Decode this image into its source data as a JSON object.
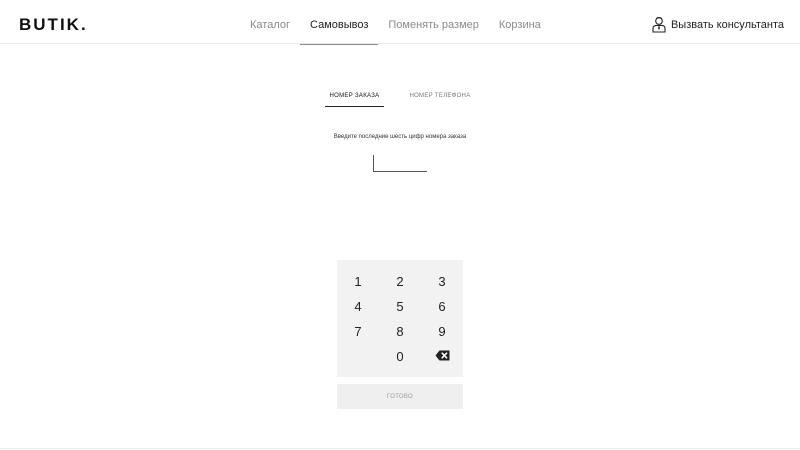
{
  "header": {
    "logo": "BUTIK.",
    "nav": [
      {
        "label": "Каталог",
        "active": false
      },
      {
        "label": "Самовывоз",
        "active": true
      },
      {
        "label": "Поменять размер",
        "active": false
      },
      {
        "label": "Корзина",
        "active": false
      }
    ],
    "consultant": {
      "label": "Вызвать консультанта",
      "icon": "consultant-person-icon"
    }
  },
  "tabs": [
    {
      "label": "НОМЕР ЗАКАЗА",
      "active": true
    },
    {
      "label": "НОМЕР ТЕЛЕФОНА",
      "active": false
    }
  ],
  "prompt": "Введите последние шесть цифр номера заказа",
  "code_input": {
    "value": ""
  },
  "keypad": {
    "keys": [
      "1",
      "2",
      "3",
      "4",
      "5",
      "6",
      "7",
      "8",
      "9",
      "",
      "0",
      "backspace-icon"
    ]
  },
  "done_label": "ГОТОВО",
  "colors": {
    "keypad_bg": "#f2f2f2",
    "done_bg": "#efefef",
    "active_text": "#222222",
    "inactive_text": "#8a8a8a"
  }
}
